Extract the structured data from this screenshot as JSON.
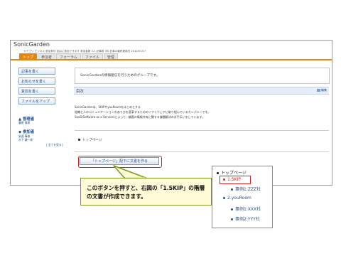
{
  "app": {
    "title": "SonicGarden",
    "meta": "カテゴリ ビジネス 参加条件 自由に参加できます 参加者数 3人 記事数 3件 記事の最終更新日 2010/07/27"
  },
  "tabs": [
    {
      "label": "トップ"
    },
    {
      "label": "参加者"
    },
    {
      "label": "フォーラム"
    },
    {
      "label": "ファイル"
    },
    {
      "label": "管理"
    }
  ],
  "sidebar": {
    "buttons": [
      {
        "label": "記事を書く"
      },
      {
        "label": "お知らせを書く"
      },
      {
        "label": "質問を書く"
      },
      {
        "label": "ファイルをアップ"
      }
    ],
    "admin_heading": "管理者",
    "admin_name": "藤原 慎郎",
    "members_heading": "参加者",
    "member_1": "安達 輝雄",
    "member_2": "水下 謙一郎",
    "see_all": "[ 全てを見る ]"
  },
  "main": {
    "intro": "SonicGardenの情報発信を行うためのグループです。",
    "toc_title": "目次",
    "edit_label": "編集",
    "desc_line1": "SonicGardenは、SKIPやyouRoomをはじめとする",
    "desc_line2": "組織と人のコミュニケーションのあり方を変革するためのソフトウェアに取り組んでいるカンパニーです。",
    "desc_line3": "SaaS(Software as a Service)によって、顧客の情報共有に関する課題解決のお手伝いをしています。",
    "toc_item": "トップページ",
    "create_button": "「トップページ」配下に文書を作る"
  },
  "callout": {
    "text": "このボタンを押すと、右図の「1.SKIP」の階層の文書が作成できます。"
  },
  "tree": {
    "root": "トップページ",
    "skip": "1.SKIP",
    "case1": "事例1:ZZZ社",
    "youroom": "2.youRoom",
    "case2": "事例1:XXX社",
    "case3": "事例2:YYY社"
  },
  "colors": {
    "accent_orange": "#e8850f",
    "link_blue": "#1f4d8a",
    "highlight_red": "#e02020",
    "callout_bg": "#fffbd8",
    "callout_border": "#7d9b1c"
  }
}
